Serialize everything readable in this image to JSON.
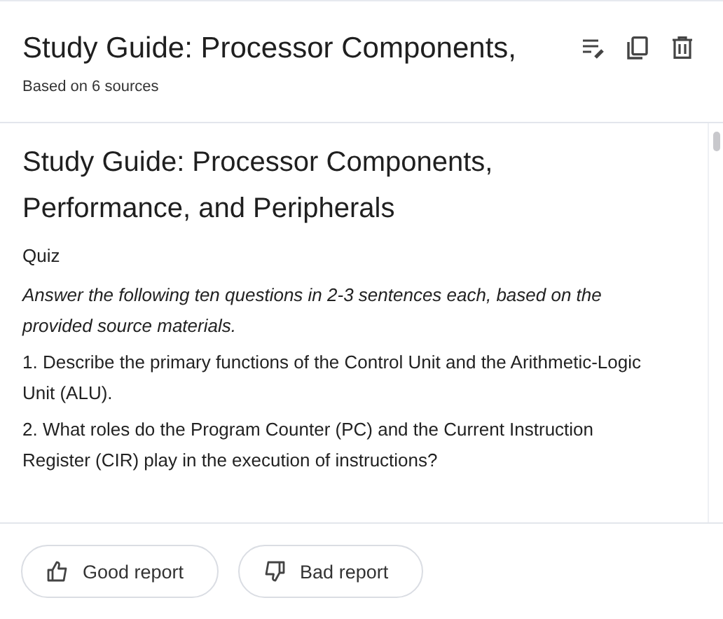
{
  "header": {
    "title": "Study Guide: Processor Components,",
    "subtitle": "Based on 6 sources"
  },
  "document": {
    "title": "Study Guide: Processor Components, Performance, and Peripherals",
    "blocks": [
      {
        "kind": "heading",
        "text": "Quiz"
      },
      {
        "kind": "instruction",
        "text": "Answer the following ten questions in 2-3 sentences each, based on the provided source materials."
      },
      {
        "kind": "paragraph",
        "text": "1. Describe the primary functions of the Control Unit and the Arithmetic-Logic Unit (ALU)."
      },
      {
        "kind": "paragraph",
        "text": "2. What roles do the Program Counter (PC) and the Current Instruction Register (CIR) play in the execution of instructions?"
      }
    ]
  },
  "footer": {
    "buttons": [
      {
        "kind": "good",
        "label": "Good report"
      },
      {
        "kind": "bad",
        "label": "Bad report"
      }
    ]
  }
}
